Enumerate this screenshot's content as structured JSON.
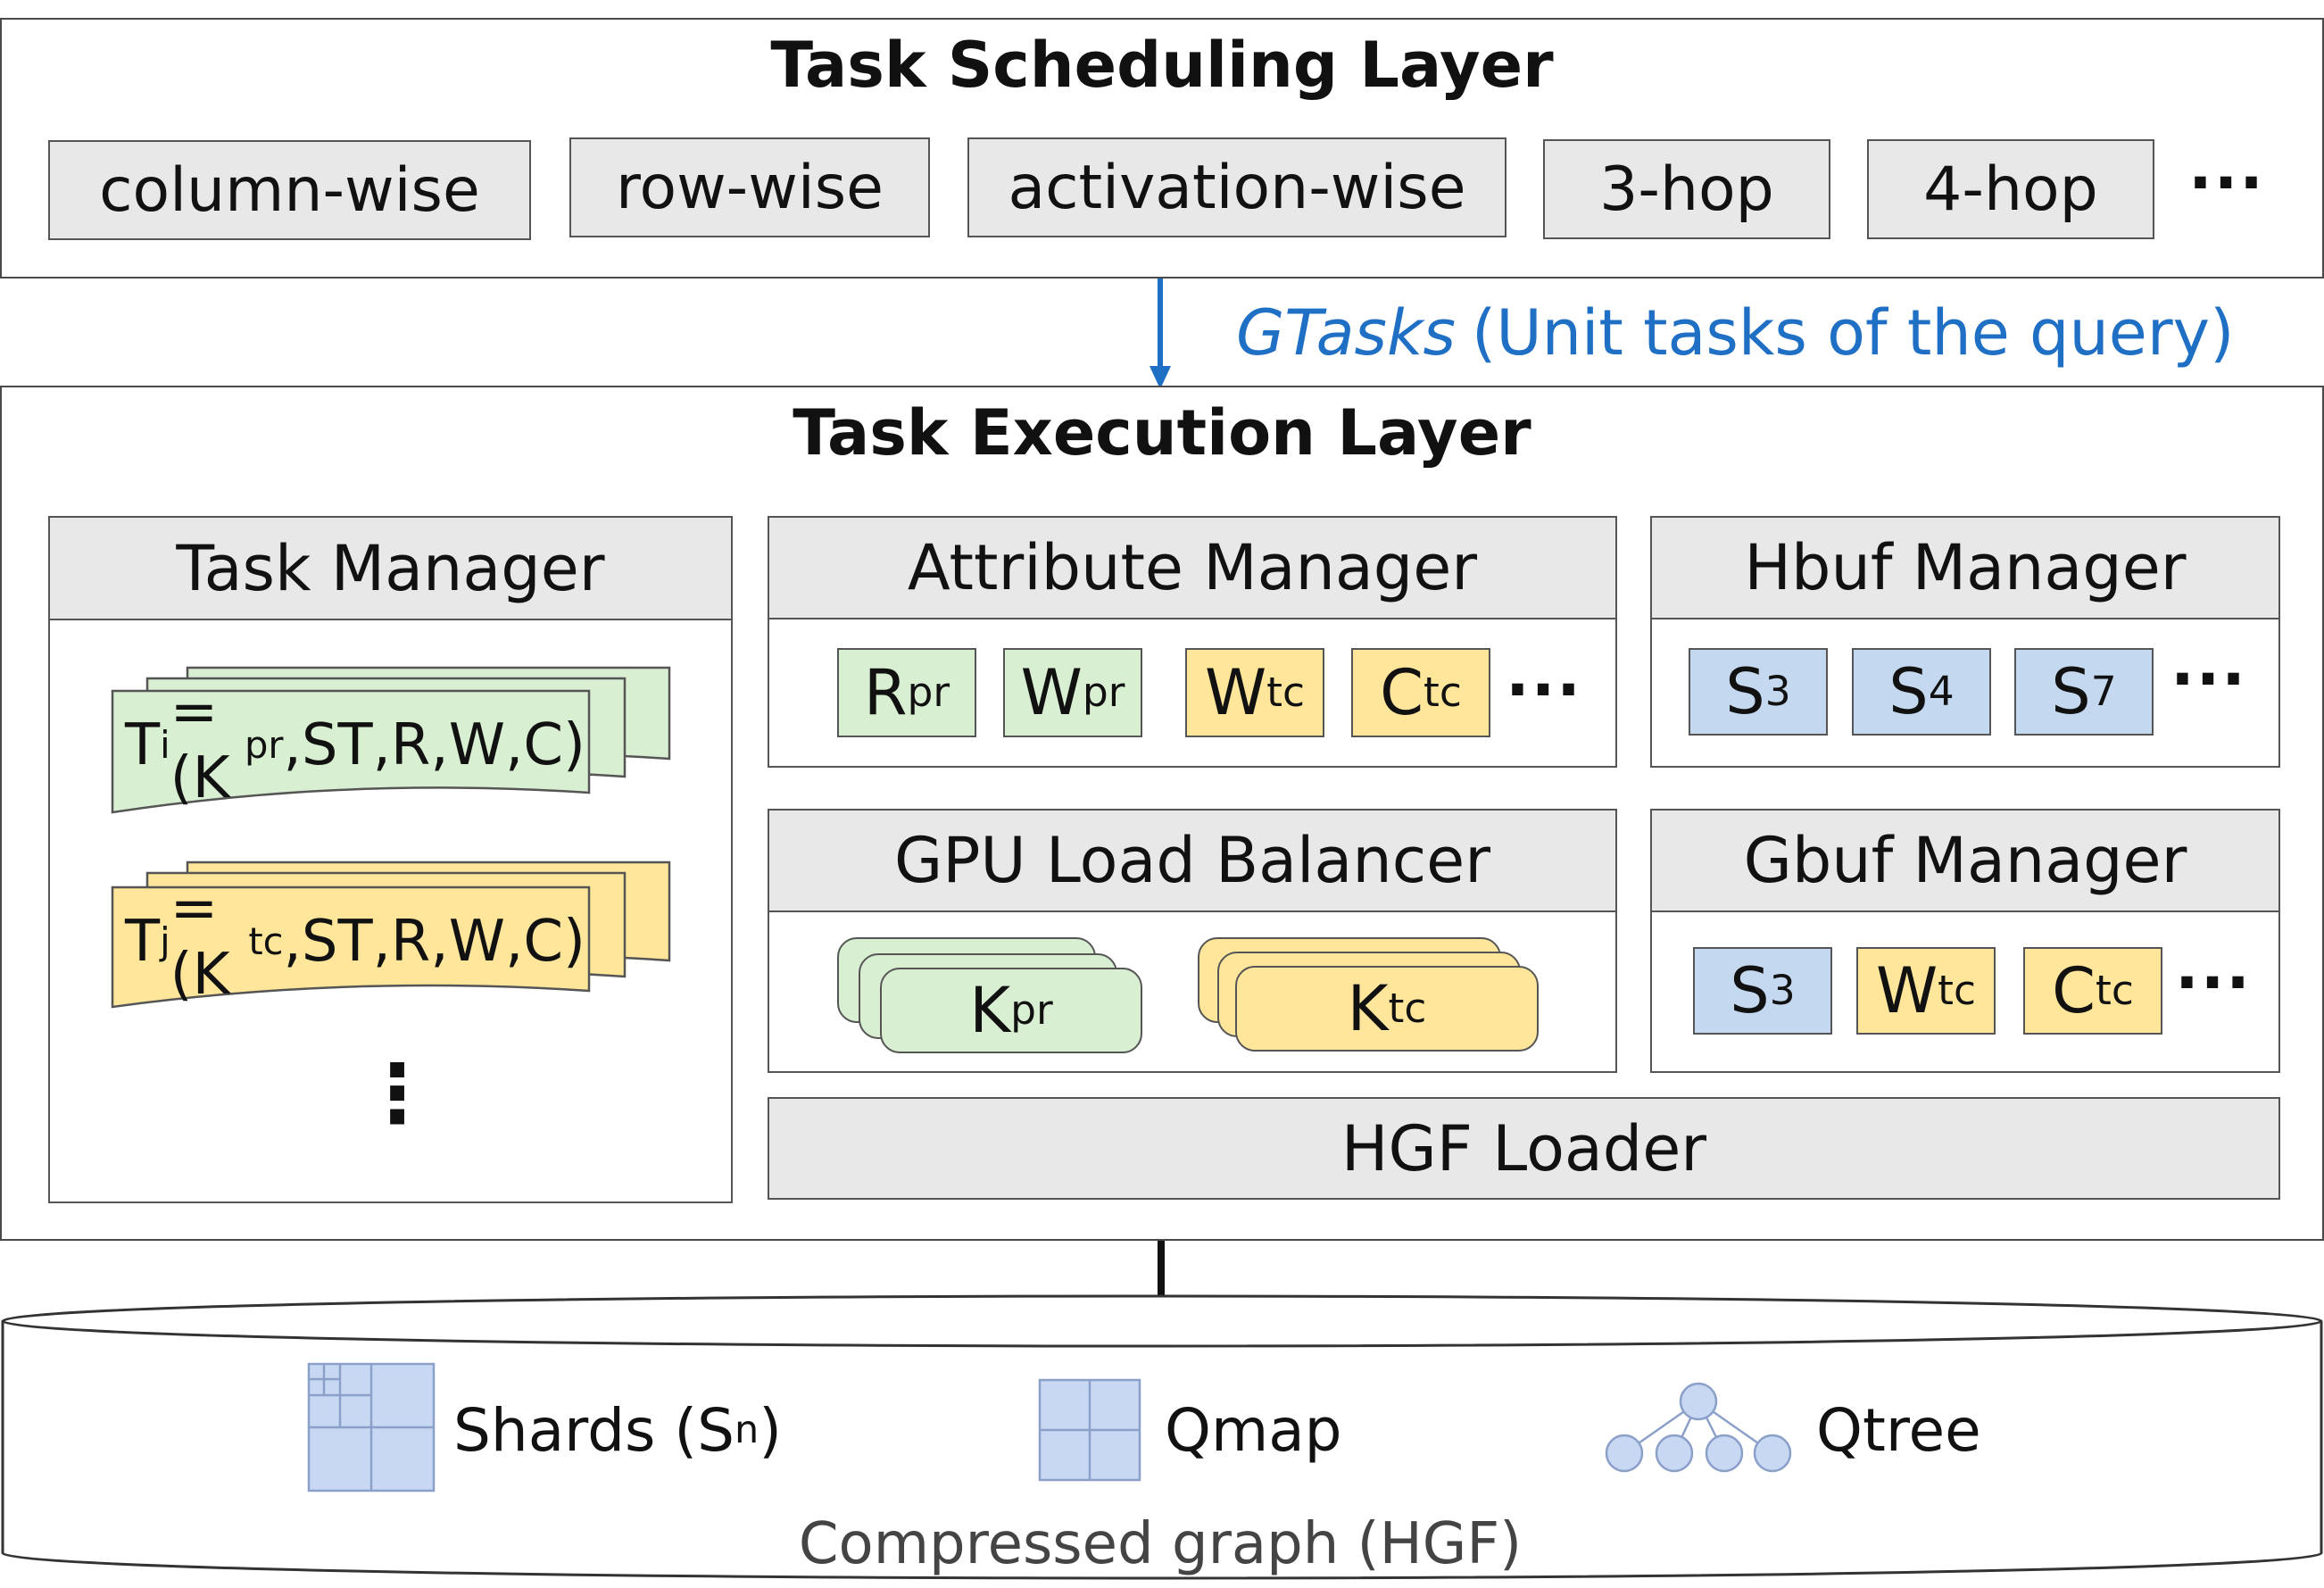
{
  "scheduling": {
    "title": "Task Scheduling Layer",
    "items": [
      "column-wise",
      "row-wise",
      "activation-wise",
      "3-hop",
      "4-hop"
    ],
    "more": "···"
  },
  "arrow_label": {
    "italic": "GTasks",
    "rest": "(Unit tasks of the query)",
    "color": "#1f6fc5"
  },
  "execution": {
    "title": "Task Execution Layer",
    "task_manager": {
      "title": "Task Manager",
      "tasks": [
        {
          "t": "T",
          "t_sub": "i",
          "pre": "=(K",
          "k_sub": "pr",
          "post": ",ST,R,W,C)",
          "color": "#d9efd2"
        },
        {
          "t": "T",
          "t_sub": "j",
          "pre": "=(K",
          "k_sub": "tc",
          "post": ",ST,R,W,C)",
          "color": "#ffe69a"
        }
      ],
      "more": "⋮"
    },
    "attribute_manager": {
      "title": "Attribute Manager",
      "items": [
        {
          "base": "R",
          "sub": "pr",
          "color": "green"
        },
        {
          "base": "W",
          "sub": "pr",
          "color": "green"
        },
        {
          "base": "W",
          "sub": "tc",
          "color": "yellow"
        },
        {
          "base": "C",
          "sub": "tc",
          "color": "yellow"
        }
      ],
      "more": "···"
    },
    "hbuf_manager": {
      "title": "Hbuf Manager",
      "items": [
        {
          "base": "S",
          "sub": "3"
        },
        {
          "base": "S",
          "sub": "4"
        },
        {
          "base": "S",
          "sub": "7"
        }
      ],
      "more": "···"
    },
    "gpu_load_balancer": {
      "title": "GPU Load Balancer",
      "kernels": [
        {
          "base": "K",
          "sub": "pr",
          "color": "green"
        },
        {
          "base": "K",
          "sub": "tc",
          "color": "yellow"
        }
      ]
    },
    "gbuf_manager": {
      "title": "Gbuf Manager",
      "items": [
        {
          "base": "S",
          "sub": "3",
          "color": "blue"
        },
        {
          "base": "W",
          "sub": "tc",
          "color": "yellow"
        },
        {
          "base": "C",
          "sub": "tc",
          "color": "yellow"
        }
      ],
      "more": "···"
    },
    "hgf_loader": {
      "title": "HGF Loader"
    }
  },
  "storage": {
    "label": "Compressed graph (HGF)",
    "shards": {
      "base": "Shards (S",
      "sub": "n",
      "close": ")"
    },
    "qmap": "Qmap",
    "qtree": "Qtree"
  }
}
